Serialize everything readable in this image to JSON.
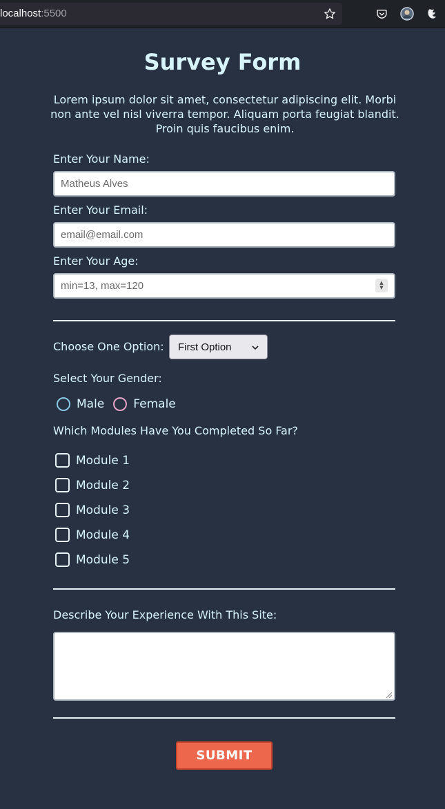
{
  "browser": {
    "url_host": "localhost",
    "url_port": ":5500"
  },
  "form": {
    "title": "Survey Form",
    "description": "Lorem ipsum dolor sit amet, consectetur adipiscing elit. Morbi non ante vel nisl viverra tempor. Aliquam porta feugiat blandit. Proin quis faucibus enim.",
    "name": {
      "label": "Enter Your Name:",
      "placeholder": "Matheus Alves",
      "value": ""
    },
    "email": {
      "label": "Enter Your Email:",
      "placeholder": "email@email.com",
      "value": ""
    },
    "age": {
      "label": "Enter Your Age:",
      "placeholder": "min=13, max=120",
      "value": ""
    },
    "option": {
      "label": "Choose One Option:",
      "selected": "First Option"
    },
    "gender": {
      "label": "Select Your Gender:",
      "options": [
        "Male",
        "Female"
      ],
      "colors": {
        "male": "#86c8e4",
        "female": "#e8a3c6"
      }
    },
    "modules": {
      "label": "Which Modules Have You Completed So Far?",
      "items": [
        "Module 1",
        "Module 2",
        "Module 3",
        "Module 4",
        "Module 5"
      ]
    },
    "experience": {
      "label": "Describe Your Experience With This Site:",
      "value": ""
    },
    "submit_label": "SUBMIT"
  },
  "colors": {
    "background": "#273142",
    "heading": "#d8f4fb",
    "submit": "#ec674c"
  }
}
